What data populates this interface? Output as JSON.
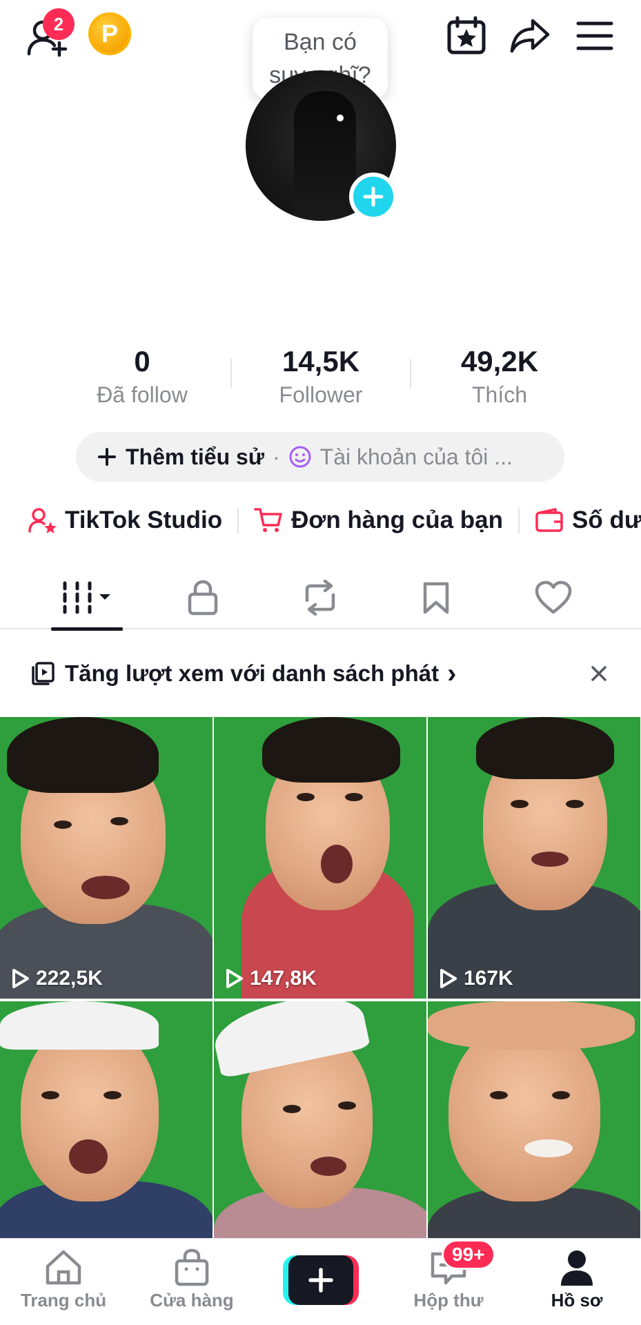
{
  "header": {
    "friend_badge": "2",
    "coin_letter": "P",
    "icons": [
      "add-friend-icon",
      "coin-icon",
      "calendar-star-icon",
      "share-icon",
      "menu-icon"
    ]
  },
  "bubble": {
    "line1": "Bạn có",
    "line2": "suy nghĩ?"
  },
  "stats": [
    {
      "value": "0",
      "label": "Đã follow"
    },
    {
      "value": "14,5K",
      "label": "Follower"
    },
    {
      "value": "49,2K",
      "label": "Thích"
    }
  ],
  "bio": {
    "add_label": "Thêm tiểu sử",
    "separator": "·",
    "account_label": "Tài khoản của tôi ..."
  },
  "links": [
    {
      "label": "TikTok Studio",
      "icon": "studio-icon"
    },
    {
      "label": "Đơn hàng của bạn",
      "icon": "cart-icon"
    },
    {
      "label": "Số dư",
      "icon": "wallet-icon"
    }
  ],
  "tabs": [
    "videos-grid-icon",
    "lock-icon",
    "repost-icon",
    "bookmark-icon",
    "heart-icon"
  ],
  "playlist": {
    "label": "Tăng lượt xem với danh sách phát",
    "chevron": "›"
  },
  "videos": [
    {
      "views": "222,5K"
    },
    {
      "views": "147,8K"
    },
    {
      "views": "167K"
    },
    {
      "views": ""
    },
    {
      "views": ""
    },
    {
      "views": ""
    }
  ],
  "nav": {
    "home": "Trang chủ",
    "shop": "Cửa hàng",
    "inbox": "Hộp thư",
    "inbox_badge": "99+",
    "profile": "Hồ sơ"
  },
  "colors": {
    "accent": "#fe2c55",
    "cyan": "#20d5ec",
    "text": "#161823",
    "muted": "#8a8b91"
  }
}
